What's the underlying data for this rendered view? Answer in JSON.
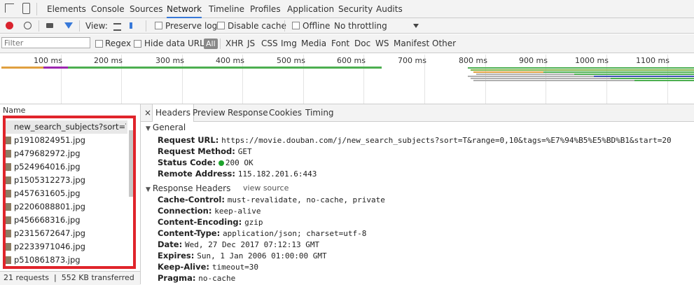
{
  "devtools": {
    "tabs": [
      "Elements",
      "Console",
      "Sources",
      "Network",
      "Timeline",
      "Profiles",
      "Application",
      "Security",
      "Audits"
    ],
    "active_tab": "Network"
  },
  "toolbar": {
    "view_label": "View:",
    "preserve_log": "Preserve log",
    "disable_cache": "Disable cache",
    "offline": "Offline",
    "throttling": "No throttling"
  },
  "filterbar": {
    "placeholder": "Filter",
    "regex": "Regex",
    "hide_data_urls": "Hide data URLs",
    "all": "All",
    "types": [
      "XHR",
      "JS",
      "CSS",
      "Img",
      "Media",
      "Font",
      "Doc",
      "WS",
      "Manifest",
      "Other"
    ]
  },
  "overview": {
    "ticks": [
      "100 ms",
      "200 ms",
      "300 ms",
      "400 ms",
      "500 ms",
      "600 ms",
      "700 ms",
      "800 ms",
      "900 ms",
      "1000 ms",
      "1100 ms"
    ]
  },
  "requests": {
    "header": "Name",
    "items": [
      "new_search_subjects?sort=T...",
      "p1910824951.jpg",
      "p479682972.jpg",
      "p524964016.jpg",
      "p1505312273.jpg",
      "p457631605.jpg",
      "p2206088801.jpg",
      "p456668316.jpg",
      "p2315672647.jpg",
      "p2233971046.jpg",
      "p510861873.jpg"
    ],
    "status": "21 requests  |  552 KB transferred"
  },
  "details": {
    "close": "×",
    "tabs": [
      "Headers",
      "Preview",
      "Response",
      "Cookies",
      "Timing"
    ],
    "active_tab": "Headers",
    "general": {
      "title": "General",
      "rows": [
        {
          "k": "Request URL:",
          "v": "https://movie.douban.com/j/new_search_subjects?sort=T&range=0,10&tags=%E7%94%B5%E5%BD%B1&start=20"
        },
        {
          "k": "Request Method:",
          "v": "GET"
        },
        {
          "k": "Status Code:",
          "v": "200 OK"
        },
        {
          "k": "Remote Address:",
          "v": "115.182.201.6:443"
        }
      ]
    },
    "response": {
      "title": "Response Headers",
      "view_source": "view source",
      "rows": [
        {
          "k": "Cache-Control:",
          "v": "must-revalidate, no-cache, private"
        },
        {
          "k": "Connection:",
          "v": "keep-alive"
        },
        {
          "k": "Content-Encoding:",
          "v": "gzip"
        },
        {
          "k": "Content-Type:",
          "v": "application/json; charset=utf-8"
        },
        {
          "k": "Date:",
          "v": "Wed, 27 Dec 2017 07:12:13 GMT"
        },
        {
          "k": "Expires:",
          "v": "Sun, 1 Jan 2006 01:00:00 GMT"
        },
        {
          "k": "Keep-Alive:",
          "v": "timeout=30"
        },
        {
          "k": "Pragma:",
          "v": "no-cache"
        }
      ]
    }
  },
  "colors": {
    "accent": "#3879d9",
    "highlight": "#e0242b",
    "record": "#d9232e",
    "status_ok": "#1da32c"
  }
}
